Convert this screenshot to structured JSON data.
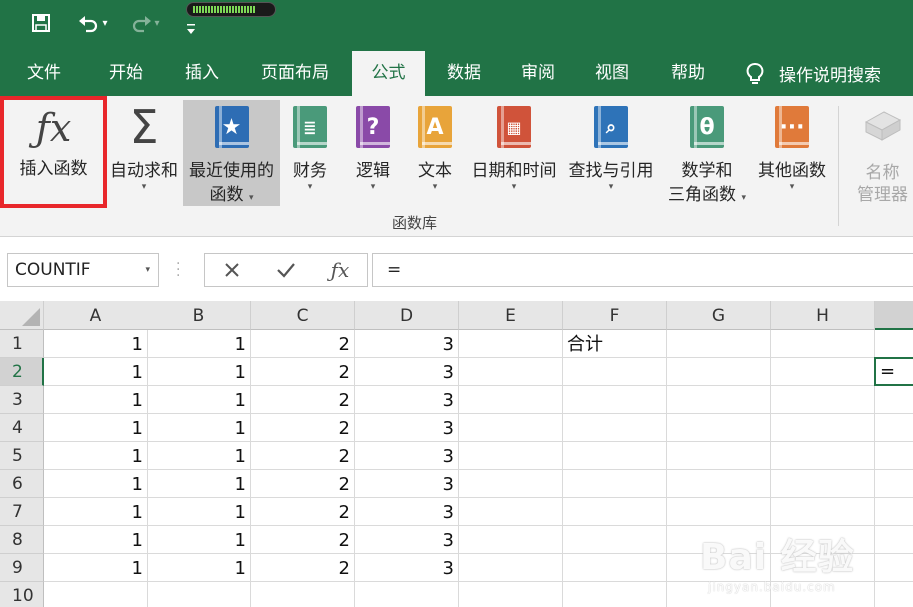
{
  "colors": {
    "brand": "#217346",
    "highlight": "#e8262a"
  },
  "quick_access": {
    "save_icon": "save-icon",
    "undo_icon": "undo-icon",
    "redo_icon": "redo-icon",
    "customize_icon": "customize-qat-icon",
    "progress": 0.8
  },
  "tabs": [
    {
      "label": "文件",
      "active": false
    },
    {
      "label": "开始",
      "active": false
    },
    {
      "label": "插入",
      "active": false
    },
    {
      "label": "页面布局",
      "active": false
    },
    {
      "label": "公式",
      "active": true
    },
    {
      "label": "数据",
      "active": false
    },
    {
      "label": "审阅",
      "active": false
    },
    {
      "label": "视图",
      "active": false
    },
    {
      "label": "帮助",
      "active": false
    }
  ],
  "tell_me": {
    "label": "操作说明搜索",
    "icon": "lightbulb-icon"
  },
  "ribbon": {
    "insert_function": {
      "label": "插入函数",
      "icon": "fx-icon"
    },
    "autosum": {
      "label": "自动求和",
      "icon": "sigma-icon"
    },
    "recent": {
      "label1": "最近使用的",
      "label2": "函数",
      "icon": "star-book-icon"
    },
    "financial": {
      "label": "财务",
      "icon": "coins-book-icon"
    },
    "logical": {
      "label": "逻辑",
      "icon": "question-book-icon"
    },
    "text": {
      "label": "文本",
      "icon": "a-book-icon"
    },
    "datetime": {
      "label": "日期和时间",
      "icon": "calendar-book-icon"
    },
    "lookup": {
      "label": "查找与引用",
      "icon": "magnifier-book-icon"
    },
    "math": {
      "label1": "数学和",
      "label2": "三角函数",
      "icon": "theta-book-icon"
    },
    "more": {
      "label": "其他函数",
      "icon": "dots-book-icon"
    },
    "name_manager": {
      "label1": "名称",
      "label2": "管理器",
      "icon": "tag-icon"
    },
    "group_label": "函数库"
  },
  "formula_bar": {
    "name_box": "COUNTIF",
    "cancel_icon": "cancel-icon",
    "enter_icon": "check-icon",
    "fx_icon": "fx-icon",
    "formula": "="
  },
  "sheet": {
    "columns": [
      "A",
      "B",
      "C",
      "D",
      "E",
      "F",
      "G",
      "H"
    ],
    "rows": [
      "1",
      "2",
      "3",
      "4",
      "5",
      "6",
      "7",
      "8",
      "9",
      "10"
    ],
    "selected_row": "2",
    "cells": [
      [
        "1",
        "1",
        "2",
        "3",
        "",
        "合计",
        "",
        ""
      ],
      [
        "1",
        "1",
        "2",
        "3",
        "",
        "",
        "",
        ""
      ],
      [
        "1",
        "1",
        "2",
        "3",
        "",
        "",
        "",
        ""
      ],
      [
        "1",
        "1",
        "2",
        "3",
        "",
        "",
        "",
        ""
      ],
      [
        "1",
        "1",
        "2",
        "3",
        "",
        "",
        "",
        ""
      ],
      [
        "1",
        "1",
        "2",
        "3",
        "",
        "",
        "",
        ""
      ],
      [
        "1",
        "1",
        "2",
        "3",
        "",
        "",
        "",
        ""
      ],
      [
        "1",
        "1",
        "2",
        "3",
        "",
        "",
        "",
        ""
      ],
      [
        "1",
        "1",
        "2",
        "3",
        "",
        "",
        "",
        ""
      ],
      [
        "",
        "",
        "",
        "",
        "",
        "",
        "",
        ""
      ]
    ],
    "active_cell_value": "="
  },
  "watermark": {
    "brand": "Bai 经验",
    "site": "jingyan.baidu.com"
  }
}
